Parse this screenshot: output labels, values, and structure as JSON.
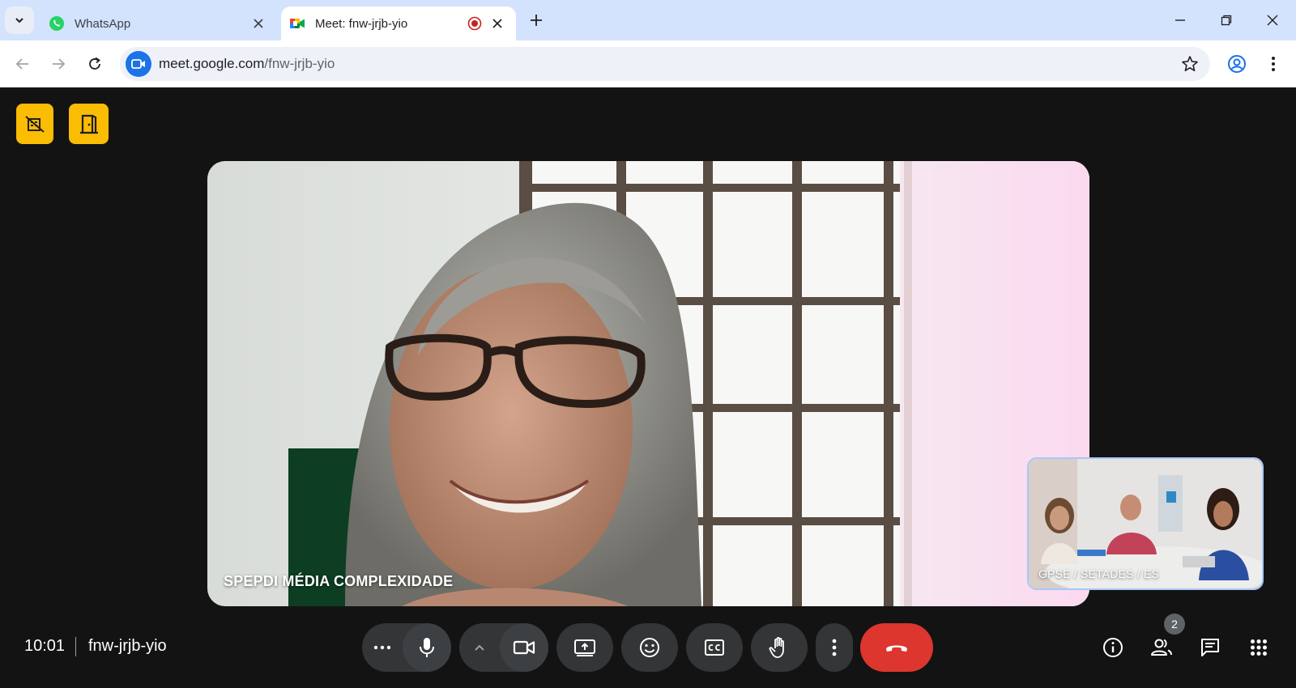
{
  "browser": {
    "tabs": [
      {
        "title": "WhatsApp",
        "active": false
      },
      {
        "title": "Meet: fnw-jrjb-yio",
        "active": true,
        "recording": true
      }
    ],
    "url_host": "meet.google.com",
    "url_path": "/fnw-jrjb-yio"
  },
  "meeting": {
    "time": "10:01",
    "code": "fnw-jrjb-yio",
    "main_participant": "SPEPDI MÉDIA COMPLEXIDADE",
    "self_participant": "GPSE / SETADES / ES",
    "participant_count": "2"
  },
  "colors": {
    "accent_yellow": "#fbbc04",
    "end_call_red": "#dc362e",
    "tab_strip": "#d3e3fd",
    "stage_bg": "#131314"
  },
  "icons": {
    "top_left": [
      "no-wallpaper-icon",
      "leave-door-icon"
    ],
    "controls": [
      "more-dots-icon",
      "microphone-icon",
      "chevron-up-icon",
      "camera-icon",
      "present-screen-icon",
      "emoji-icon",
      "captions-icon",
      "raise-hand-icon",
      "more-vert-icon",
      "end-call-icon"
    ],
    "right": [
      "info-icon",
      "people-icon",
      "chat-icon",
      "activities-icon"
    ]
  }
}
